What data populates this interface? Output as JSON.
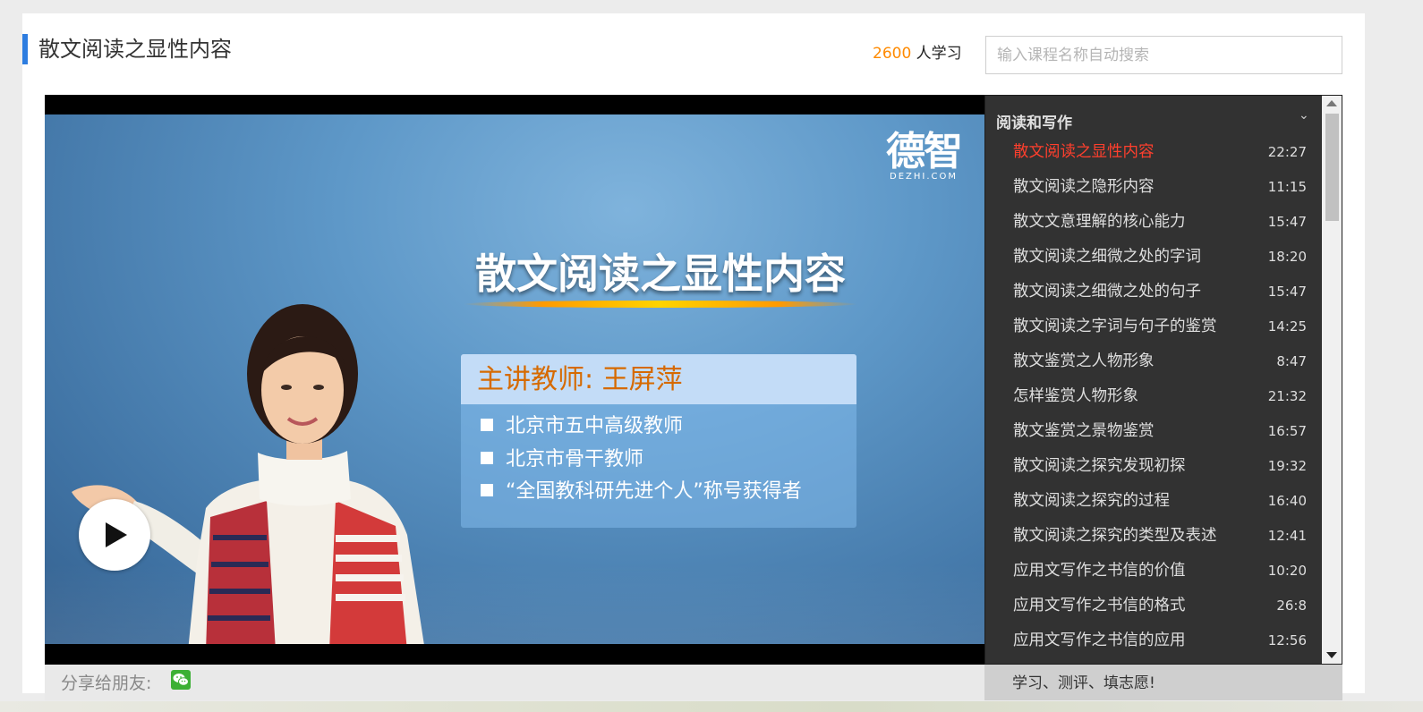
{
  "page": {
    "title": "散文阅读之显性内容",
    "learner_count": "2600",
    "learner_suffix": "人学习",
    "search_placeholder": "输入课程名称自动搜索"
  },
  "video": {
    "logo_main": "德智",
    "logo_sub": "DEZHI.COM",
    "slide_title": "散文阅读之显性内容",
    "teacher_heading": "主讲教师: 王屏萍",
    "teacher_lines": [
      "北京市五中高级教师",
      "北京市骨干教师",
      "“全国教科研先进个人”称号获得者"
    ]
  },
  "playlist": {
    "section_title": "阅读和写作",
    "items": [
      {
        "title": "散文阅读之显性内容",
        "duration": "22:27",
        "active": true
      },
      {
        "title": "散文阅读之隐形内容",
        "duration": "11:15",
        "active": false
      },
      {
        "title": "散文文意理解的核心能力",
        "duration": "15:47",
        "active": false
      },
      {
        "title": "散文阅读之细微之处的字词",
        "duration": "18:20",
        "active": false
      },
      {
        "title": "散文阅读之细微之处的句子",
        "duration": "15:47",
        "active": false
      },
      {
        "title": "散文阅读之字词与句子的鉴赏",
        "duration": "14:25",
        "active": false
      },
      {
        "title": "散文鉴赏之人物形象",
        "duration": "8:47",
        "active": false
      },
      {
        "title": "怎样鉴赏人物形象",
        "duration": "21:32",
        "active": false
      },
      {
        "title": "散文鉴赏之景物鉴赏",
        "duration": "16:57",
        "active": false
      },
      {
        "title": "散文阅读之探究发现初探",
        "duration": "19:32",
        "active": false
      },
      {
        "title": "散文阅读之探究的过程",
        "duration": "16:40",
        "active": false
      },
      {
        "title": "散文阅读之探究的类型及表述",
        "duration": "12:41",
        "active": false
      },
      {
        "title": "应用文写作之书信的价值",
        "duration": "10:20",
        "active": false
      },
      {
        "title": "应用文写作之书信的格式",
        "duration": "26:8",
        "active": false
      },
      {
        "title": "应用文写作之书信的应用",
        "duration": "12:56",
        "active": false
      }
    ]
  },
  "share": {
    "label": "分享给朋友:",
    "promo": "学习、测评、填志愿!"
  },
  "colors": {
    "accent": "#2d7de0",
    "count": "#ff8a00",
    "active_item": "#ff3f2d",
    "playlist_bg": "#323232"
  }
}
